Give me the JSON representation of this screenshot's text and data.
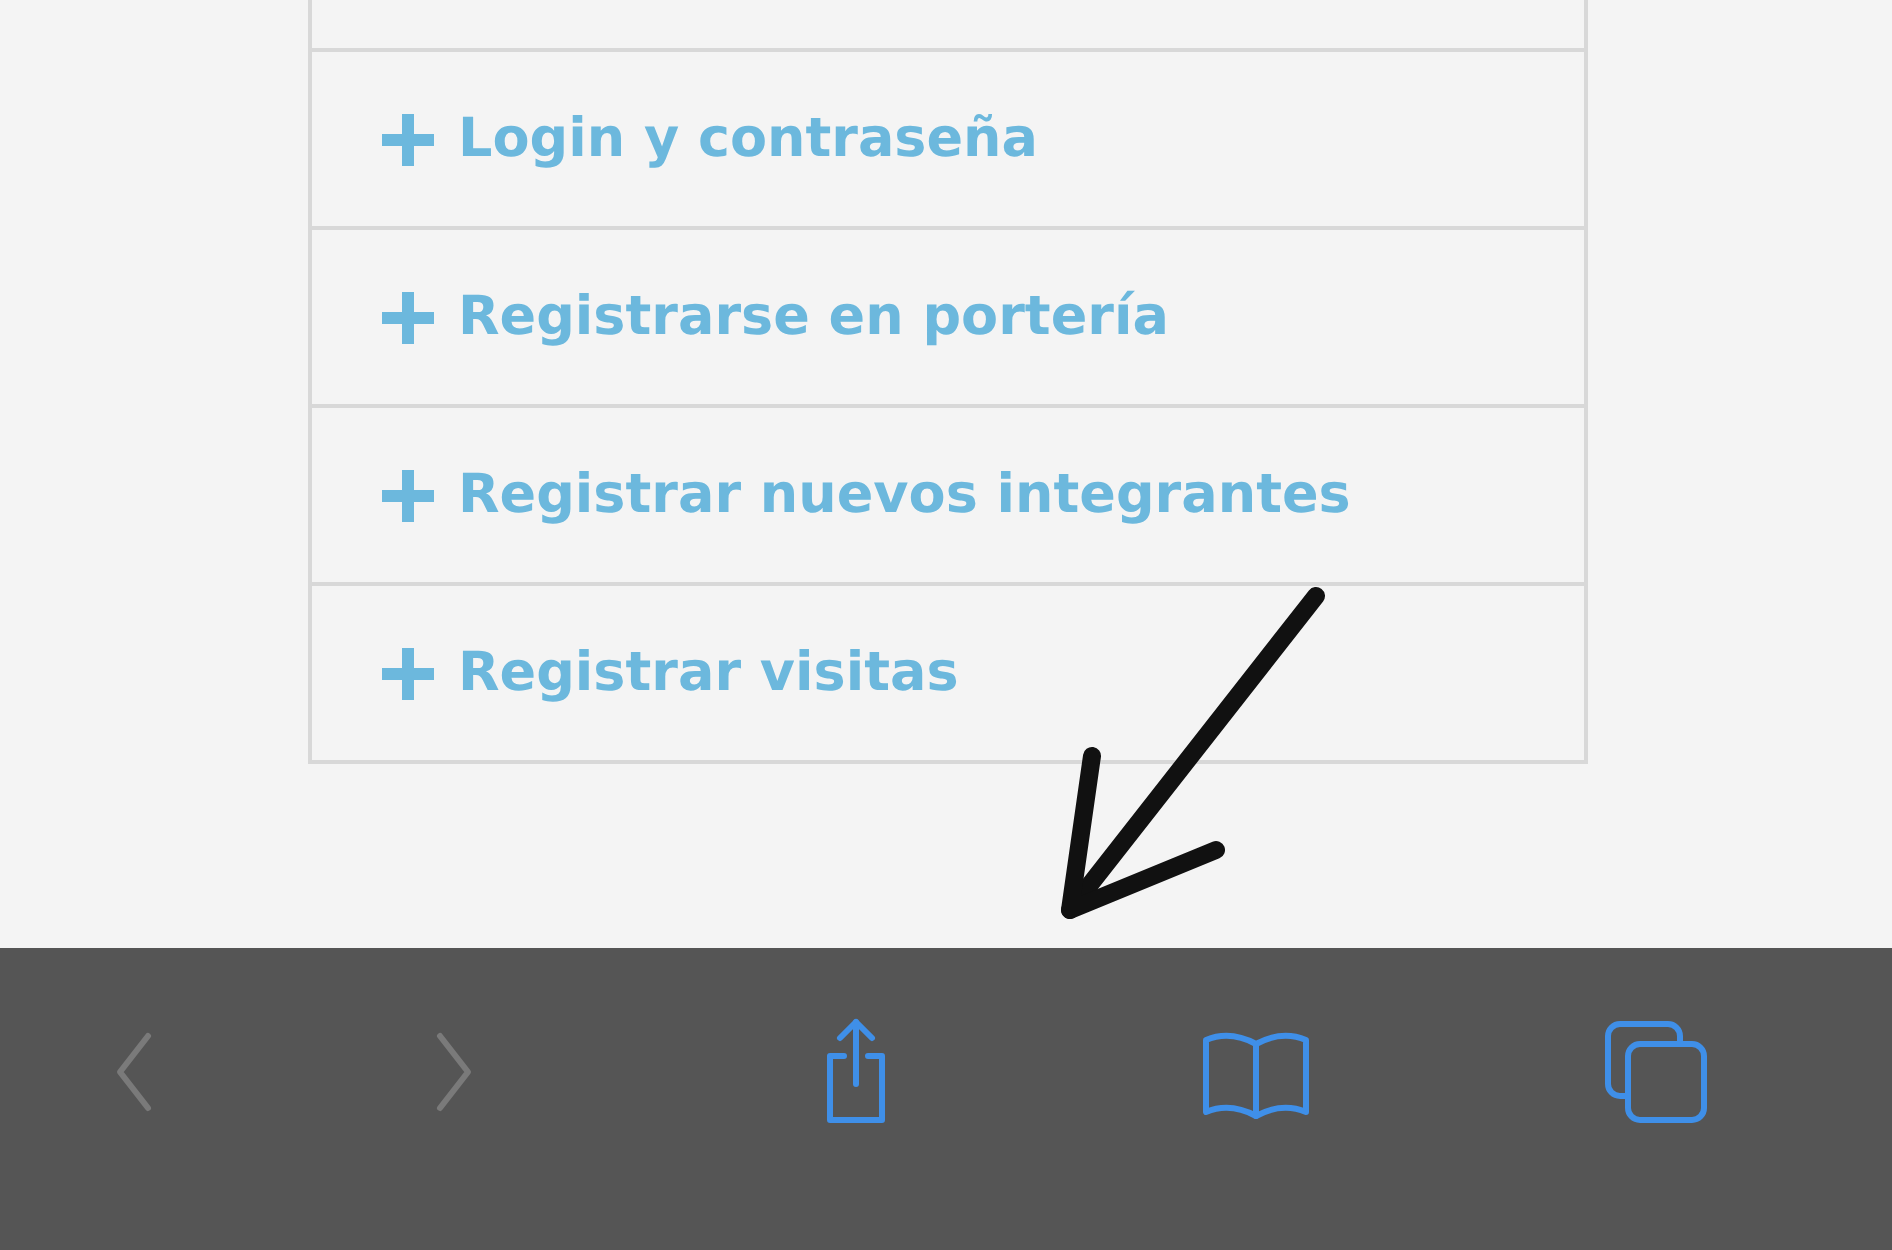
{
  "accordion": {
    "items": [
      {
        "label": "Login y contraseña",
        "expanded": false
      },
      {
        "label": "Registrarse en portería",
        "expanded": false
      },
      {
        "label": "Registrar nuevos integrantes",
        "expanded": false
      },
      {
        "label": "Registrar visitas",
        "expanded": false
      }
    ]
  },
  "toolbar": {
    "buttons": [
      {
        "kind": "back",
        "disabled": true
      },
      {
        "kind": "forward",
        "disabled": true
      },
      {
        "kind": "share",
        "disabled": false
      },
      {
        "kind": "bookmarks",
        "disabled": false
      },
      {
        "kind": "tabs",
        "disabled": false
      }
    ]
  }
}
